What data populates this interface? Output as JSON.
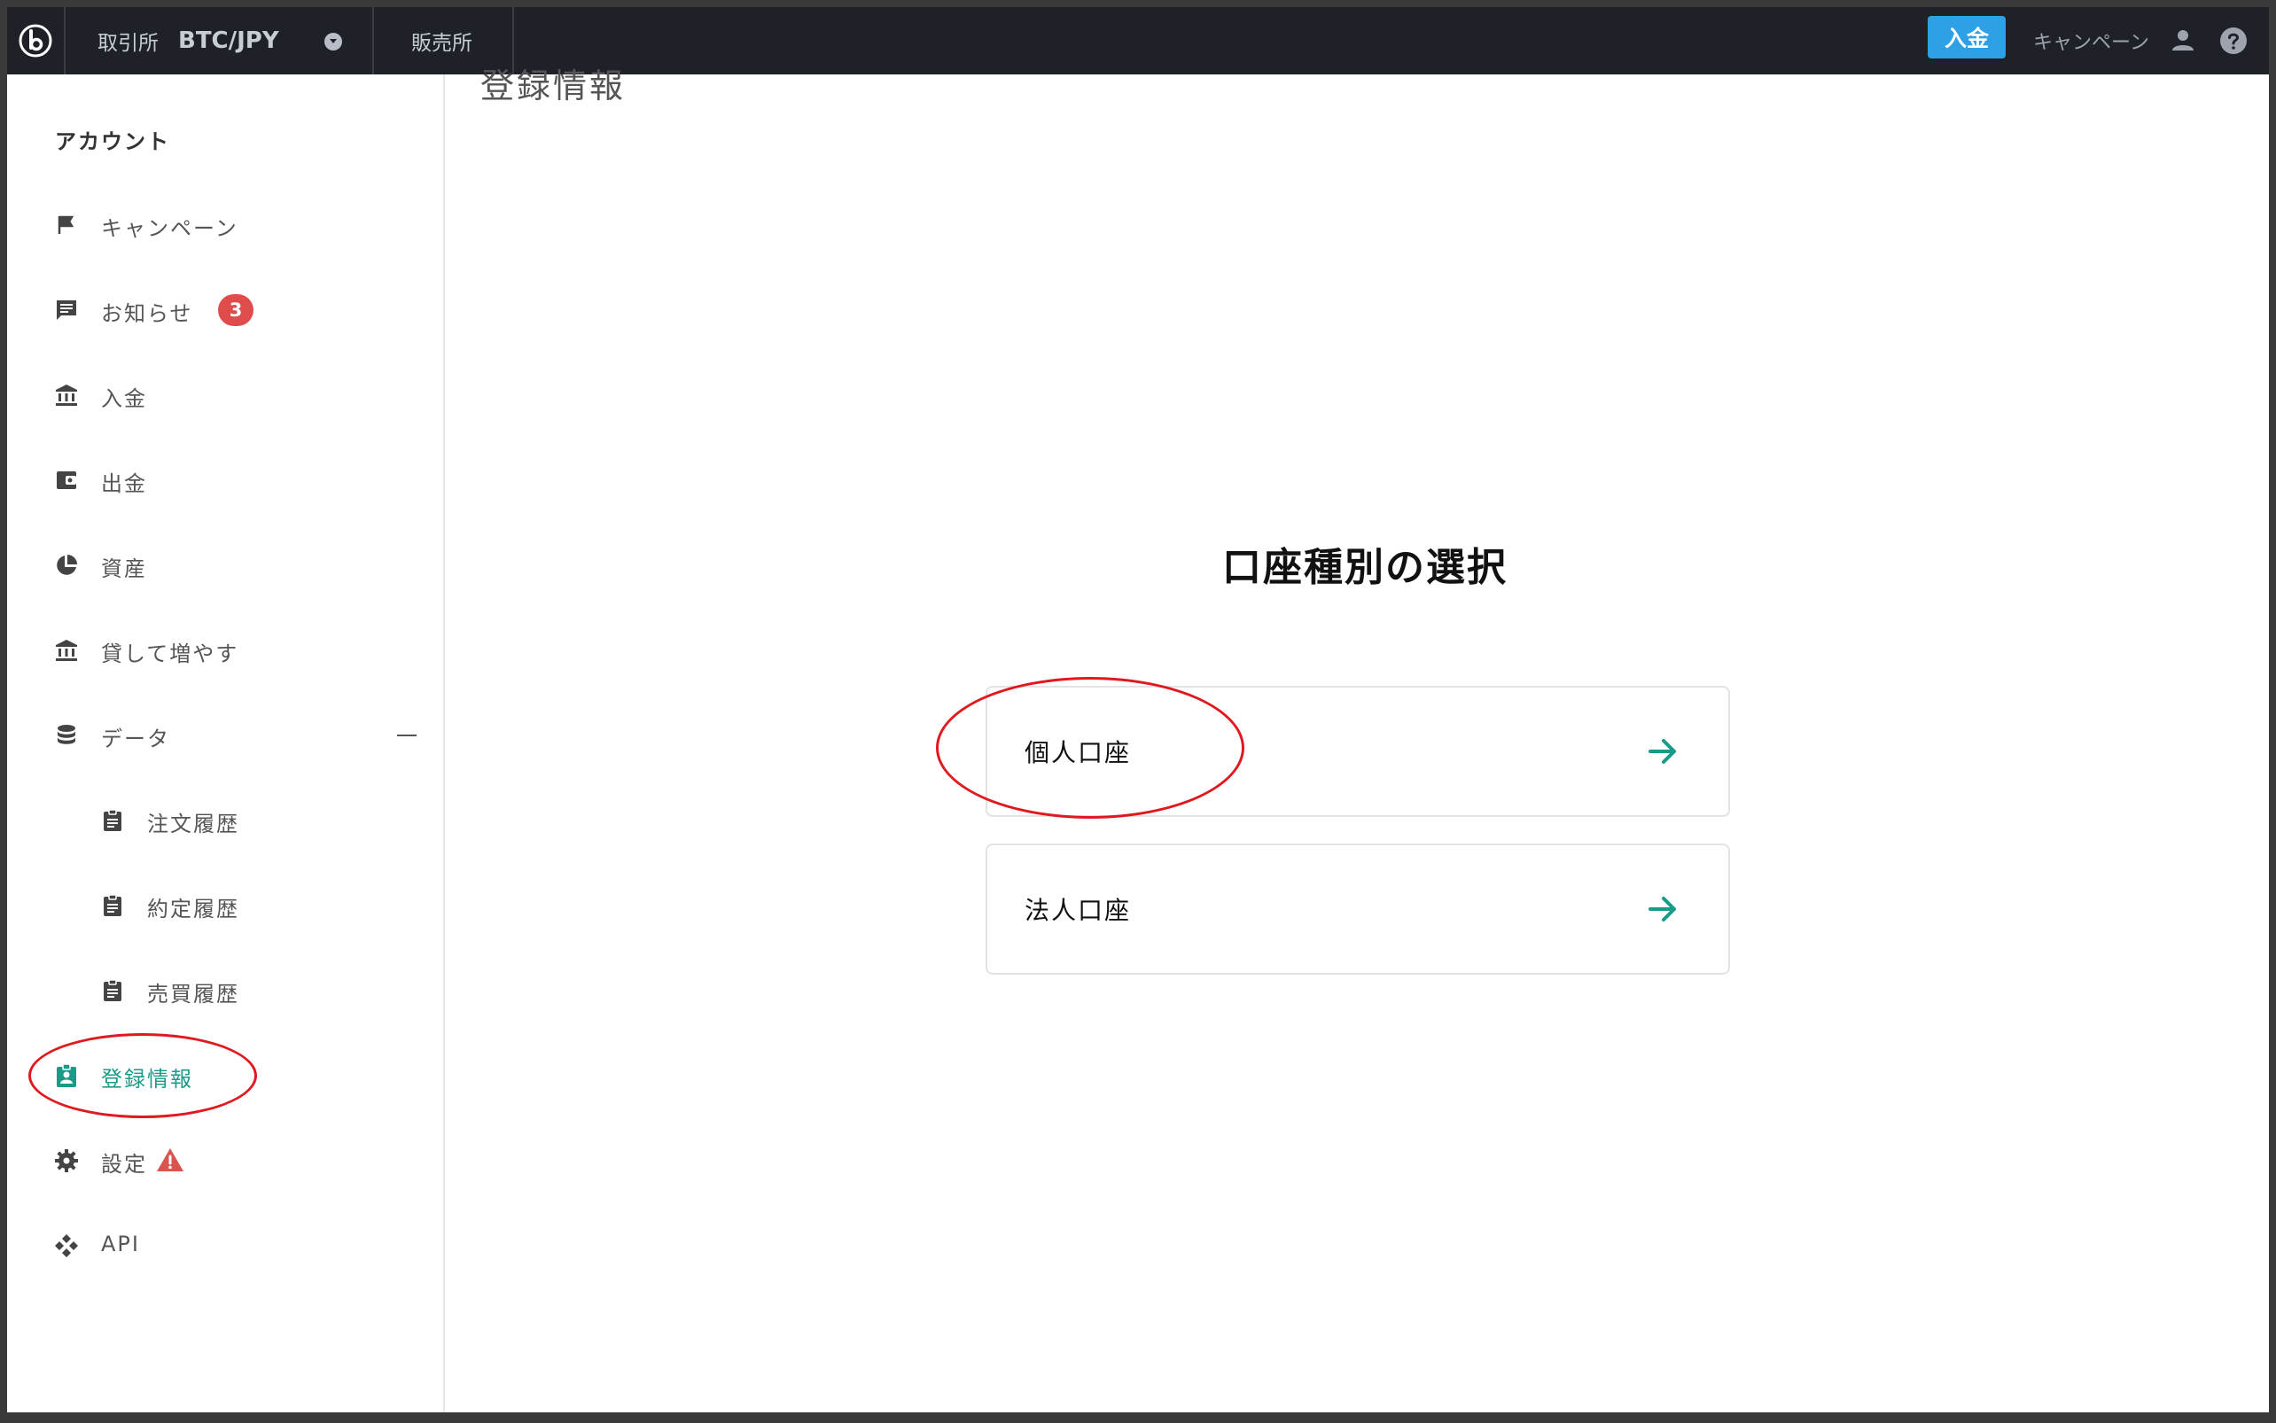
{
  "topbar": {
    "exchange_label": "取引所",
    "pair": "BTC/JPY",
    "store_label": "販売所",
    "deposit_button": "入金",
    "campaign_label": "キャンペーン"
  },
  "sidebar": {
    "title": "アカウント",
    "items": [
      {
        "label": "キャンペーン",
        "icon": "flag-icon"
      },
      {
        "label": "お知らせ",
        "icon": "message-icon",
        "badge": "3"
      },
      {
        "label": "入金",
        "icon": "bank-icon"
      },
      {
        "label": "出金",
        "icon": "wallet-icon"
      },
      {
        "label": "資産",
        "icon": "pie-chart-icon"
      },
      {
        "label": "貸して増やす",
        "icon": "bank-icon"
      },
      {
        "label": "データ",
        "icon": "database-icon",
        "expanded": true
      },
      {
        "label": "注文履歴",
        "icon": "clipboard-icon"
      },
      {
        "label": "約定履歴",
        "icon": "clipboard-icon"
      },
      {
        "label": "売買履歴",
        "icon": "clipboard-icon"
      },
      {
        "label": "登録情報",
        "icon": "id-card-icon",
        "active": true
      },
      {
        "label": "設定",
        "icon": "gear-icon",
        "warning": true
      },
      {
        "label": "API",
        "icon": "api-icon"
      }
    ]
  },
  "main": {
    "page_title": "登録情報",
    "section_title": "口座種別の選択",
    "options": [
      {
        "label": "個人口座"
      },
      {
        "label": "法人口座"
      }
    ]
  },
  "colors": {
    "topbar_bg": "#1f2129",
    "accent_teal": "#1a9a88",
    "deposit_blue": "#2ea0e6",
    "badge_red": "#e04b4b",
    "annotation_red": "#e0191f"
  }
}
